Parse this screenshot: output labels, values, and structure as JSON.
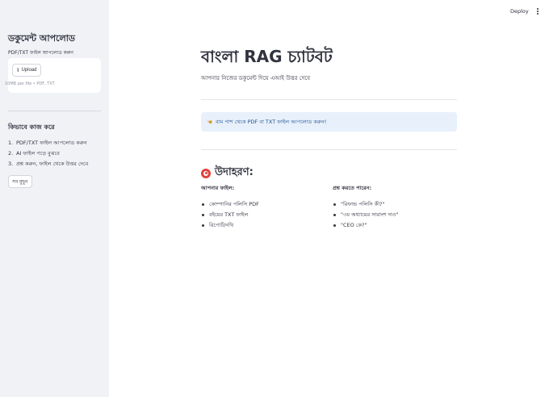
{
  "sidebar": {
    "title": "ডকুমেন্ট আপলোড",
    "subtitle": "PDF/TXT ফাইল আপলোড করুন",
    "upload_button": "Upload",
    "upload_hint": "10MB per file • PDF, TXT",
    "how_title": "কিভাবে কাজ করে",
    "steps": [
      {
        "num": "1.",
        "text": "PDF/TXT ফাইল আপলোড করুন"
      },
      {
        "num": "2.",
        "text": "AI ফাইল পড়ে বুঝবে"
      },
      {
        "num": "3.",
        "text": "প্রশ্ন করুন, ফাইল থেকে উত্তর দেবে"
      }
    ],
    "reset_button": "সব মুছুন"
  },
  "header": {
    "deploy_label": "Deploy",
    "menu_icon": "vertical-dots-icon"
  },
  "main": {
    "title": "বাংলা RAG চ্যাটবট",
    "subtitle": "আপনার নিজের ডকুমেন্ট দিয়ে এআই উত্তর দেবে",
    "info_icon": "pointing-hand-icon",
    "info_text": "বাম পাশ থেকে PDF বা TXT ফাইল আপলোড করুন!",
    "examples_icon": "target-icon",
    "examples_title": "উদাহরণ:",
    "files_heading": "আপনার ফাইল:",
    "files": [
      "কোম্পানির পলিসি PDF",
      "বইয়ের TXT ফাইল",
      "রিপোর্ট/নথি"
    ],
    "questions_heading": "প্রশ্ন করতে পারেন:",
    "questions": [
      "\"রিফান্ড পলিসি কী?\"",
      "\"৩য় অধ্যায়ের সারাংশ দাও\"",
      "\"CEO কে?\""
    ]
  },
  "colors": {
    "sidebar_bg": "#f0f2f6",
    "info_bg": "#e7f0fb",
    "info_text": "#1d4f91",
    "text": "#31333f"
  }
}
